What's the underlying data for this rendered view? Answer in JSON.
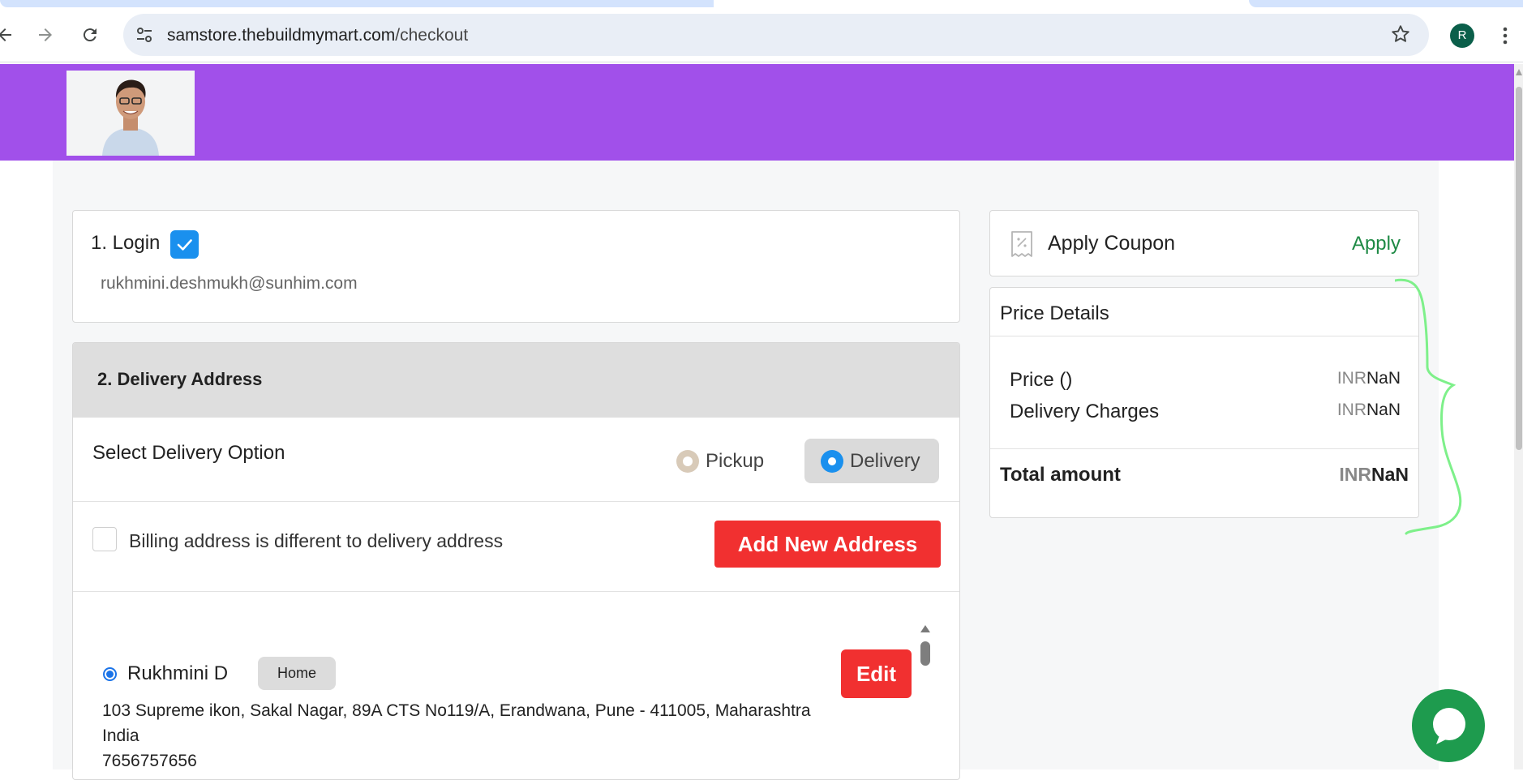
{
  "browser": {
    "url_host": "samstore.thebuildmymart.com",
    "url_path": "/checkout",
    "profile_initial": "R"
  },
  "login": {
    "title": "1. Login",
    "email": "rukhmini.deshmukh@sunhim.com"
  },
  "delivery": {
    "title": "2. Delivery Address",
    "option_label": "Select Delivery Option",
    "options": [
      {
        "label": "Pickup",
        "selected": false
      },
      {
        "label": "Delivery",
        "selected": true
      }
    ],
    "billing_label": "Billing address is different to delivery address",
    "add_address_label": "Add New Address"
  },
  "address": {
    "name": "Rukhmini D",
    "tag": "Home",
    "edit_label": "Edit",
    "line1": "103 Supreme ikon, Sakal Nagar, 89A CTS No119/A, Erandwana, Pune - 411005, Maharashtra",
    "line2": "India",
    "phone": "7656757656"
  },
  "coupon": {
    "label": "Apply Coupon",
    "action": "Apply"
  },
  "price": {
    "title": "Price Details",
    "rows": [
      {
        "label": "Price ()",
        "currency": "INR",
        "value": "NaN"
      },
      {
        "label": "Delivery Charges",
        "currency": "INR",
        "value": "NaN"
      }
    ],
    "total_label": "Total amount",
    "total_currency": "INR",
    "total_value": "NaN"
  },
  "colors": {
    "header_bg": "#a150ea",
    "primary_button": "#f13030",
    "apply_link": "#1e8a45",
    "checkbox_blue": "#1a90ee",
    "chat_green": "#1e9b4e"
  }
}
